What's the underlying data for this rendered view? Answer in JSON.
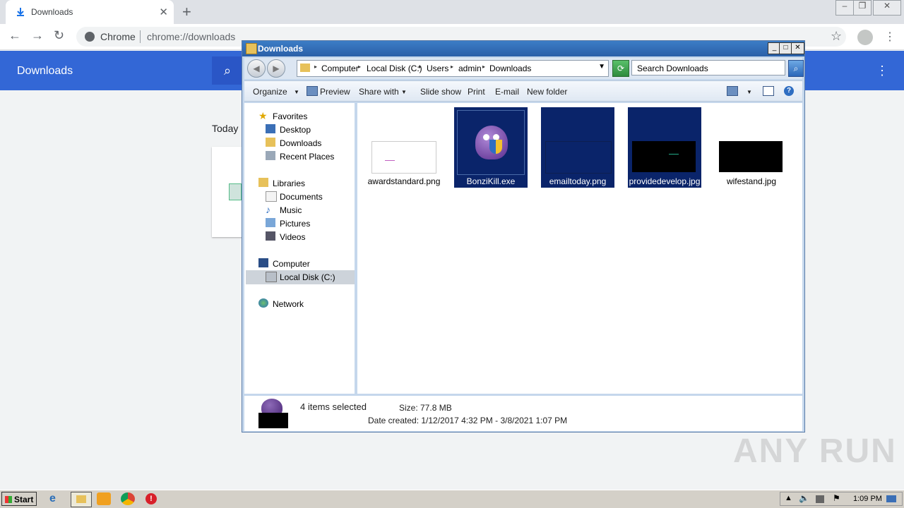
{
  "browser": {
    "tab_title": "Downloads",
    "site_name": "Chrome",
    "url": "chrome://downloads",
    "page_title": "Downloads",
    "section_today": "Today"
  },
  "explorer": {
    "title": "Downloads",
    "breadcrumb": [
      "Computer",
      "Local Disk (C:)",
      "Users",
      "admin",
      "Downloads"
    ],
    "search_placeholder": "Search Downloads",
    "commands": [
      "Organize",
      "Preview",
      "Share with",
      "Slide show",
      "Print",
      "E-mail",
      "New folder"
    ],
    "nav": {
      "favorites": "Favorites",
      "favorites_items": [
        "Desktop",
        "Downloads",
        "Recent Places"
      ],
      "libraries": "Libraries",
      "libraries_items": [
        "Documents",
        "Music",
        "Pictures",
        "Videos"
      ],
      "computer": "Computer",
      "computer_items": [
        "Local Disk (C:)"
      ],
      "network": "Network"
    },
    "files": [
      {
        "name": "awardstandard.png",
        "selected": false
      },
      {
        "name": "BonziKill.exe",
        "selected": true
      },
      {
        "name": "emailtoday.png",
        "selected": true
      },
      {
        "name": "providedevelop.jpg",
        "selected": true
      },
      {
        "name": "wifestand.jpg",
        "selected": false
      }
    ],
    "details": {
      "selection": "4 items selected",
      "size": "Size: 77.8 MB",
      "date_created": "Date created: 1/12/2017 4:32 PM - 3/8/2021 1:07 PM"
    }
  },
  "taskbar": {
    "start_label": "Start",
    "clock": "1:09 PM"
  },
  "watermark": "ANY RUN",
  "colors": {
    "chrome_header": "#3367d6",
    "selection": "#0a246a",
    "titlebar": "#2a5fa8"
  }
}
